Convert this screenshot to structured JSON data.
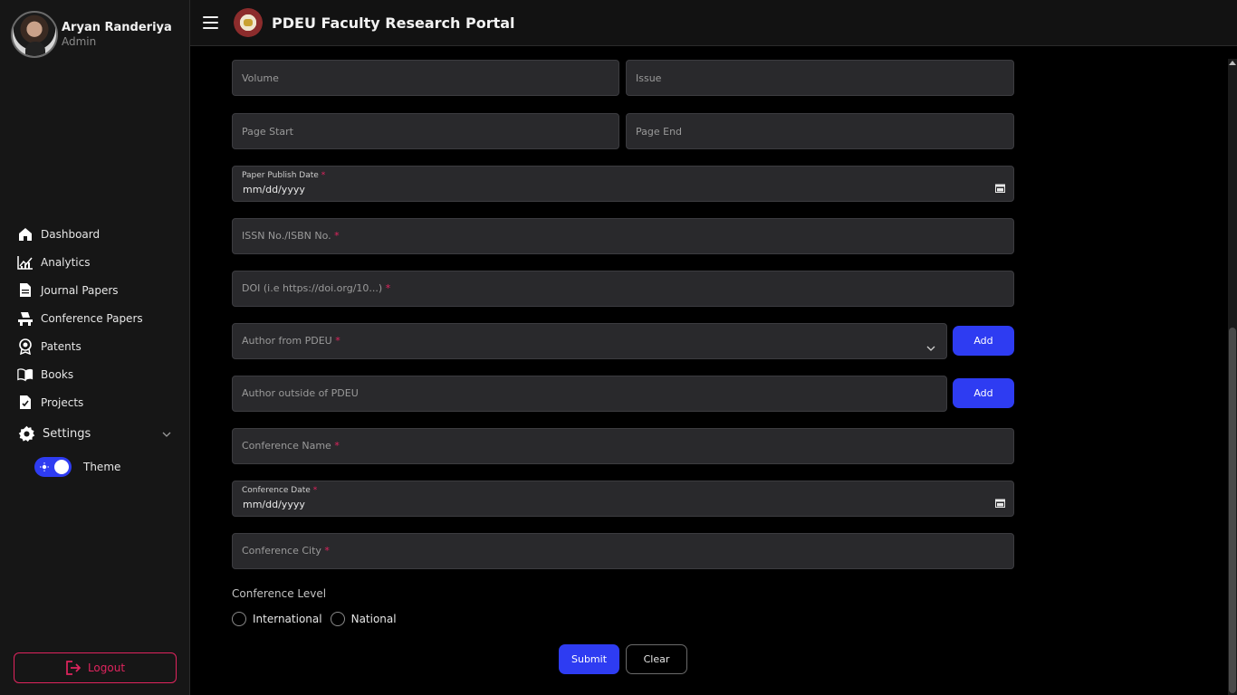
{
  "header": {
    "title": "PDEU Faculty Research Portal"
  },
  "profile": {
    "name": "Aryan Randeriya",
    "role": "Admin"
  },
  "sidebar": {
    "items": [
      {
        "label": "Dashboard",
        "icon": "home-icon"
      },
      {
        "label": "Analytics",
        "icon": "chart-icon"
      },
      {
        "label": "Journal Papers",
        "icon": "document-icon"
      },
      {
        "label": "Conference Papers",
        "icon": "conference-icon"
      },
      {
        "label": "Patents",
        "icon": "award-icon"
      },
      {
        "label": "Books",
        "icon": "book-icon"
      },
      {
        "label": "Projects",
        "icon": "project-icon"
      }
    ],
    "settings_label": "Settings",
    "theme_label": "Theme",
    "theme_dark": true,
    "logout_label": "Logout"
  },
  "form": {
    "volume_placeholder": "Volume",
    "issue_placeholder": "Issue",
    "page_start_placeholder": "Page Start",
    "page_end_placeholder": "Page End",
    "publish_date_label": "Paper Publish Date",
    "publish_date_value": "mm/dd/yyyy",
    "issn_label": "ISSN No./ISBN No.",
    "doi_label": "DOI (i.e https://doi.org/10...)",
    "author_pdeu_label": "Author from PDEU",
    "author_outside_label": "Author outside of PDEU",
    "add_label": "Add",
    "conference_name_label": "Conference Name",
    "conference_date_label": "Conference Date",
    "conference_date_value": "mm/dd/yyyy",
    "conference_city_label": "Conference City",
    "required_mark": "*",
    "level_title": "Conference Level",
    "level_options": [
      "International",
      "National"
    ],
    "submit_label": "Submit",
    "clear_label": "Clear"
  },
  "colors": {
    "accent": "#2e3cf2",
    "danger": "#e0245e",
    "field_bg": "#29292c"
  }
}
